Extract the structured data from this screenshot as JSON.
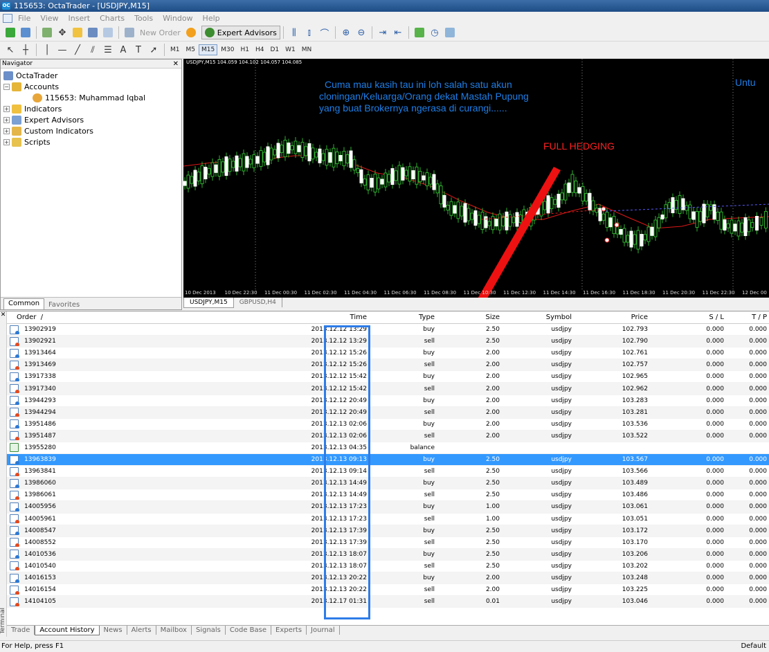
{
  "window": {
    "title": "115653: OctaTrader - [USDJPY,M15]"
  },
  "menu": [
    "File",
    "View",
    "Insert",
    "Charts",
    "Tools",
    "Window",
    "Help"
  ],
  "toolbar": {
    "new_order": "New Order",
    "expert_advisors": "Expert Advisors"
  },
  "timeframes": [
    "M1",
    "M5",
    "M15",
    "M30",
    "H1",
    "H4",
    "D1",
    "W1",
    "MN"
  ],
  "active_timeframe": "M15",
  "navigator": {
    "title": "Navigator",
    "root": "OctaTrader",
    "accounts": "Accounts",
    "account": "115653: Muhammad Iqbal",
    "indicators": "Indicators",
    "experts": "Expert Advisors",
    "custom": "Custom Indicators",
    "scripts": "Scripts",
    "tabs": [
      "Common",
      "Favorites"
    ]
  },
  "chart": {
    "info": "USDJPY,M15  104.059 104.102 104.057 104.085",
    "overlay_lines": [
      "Cuma mau kasih tau ini loh salah satu akun",
      "cloningan/Keluarga/Orang dekat Mastah Pupung",
      "yang buat Brokernya ngerasa di curangi......"
    ],
    "hedge": "FULL HEDGING",
    "untu": "Untu",
    "xlabels": [
      "10 Dec 2013",
      "10 Dec 22:30",
      "11 Dec 00:30",
      "11 Dec 02:30",
      "11 Dec 04:30",
      "11 Dec 06:30",
      "11 Dec 08:30",
      "11 Dec 10:30",
      "11 Dec 12:30",
      "11 Dec 14:30",
      "11 Dec 16:30",
      "11 Dec 18:30",
      "11 Dec 20:30",
      "11 Dec 22:30",
      "12 Dec 00"
    ],
    "tabs": [
      "USDJPY,M15",
      "GBPUSD,H4"
    ]
  },
  "terminal": {
    "columns": {
      "order": "Order",
      "time": "Time",
      "type": "Type",
      "size": "Size",
      "symbol": "Symbol",
      "price": "Price",
      "sl": "S / L",
      "tp": "T / P"
    },
    "rows": [
      {
        "order": "13902919",
        "time": "2013.12.12 13:29",
        "type": "buy",
        "size": "2.50",
        "symbol": "usdjpy",
        "price": "102.793",
        "sl": "0.000",
        "tp": "0.000"
      },
      {
        "order": "13902921",
        "time": "2013.12.12 13:29",
        "type": "sell",
        "size": "2.50",
        "symbol": "usdjpy",
        "price": "102.790",
        "sl": "0.000",
        "tp": "0.000"
      },
      {
        "order": "13913464",
        "time": "2013.12.12 15:26",
        "type": "buy",
        "size": "2.00",
        "symbol": "usdjpy",
        "price": "102.761",
        "sl": "0.000",
        "tp": "0.000"
      },
      {
        "order": "13913469",
        "time": "2013.12.12 15:26",
        "type": "sell",
        "size": "2.00",
        "symbol": "usdjpy",
        "price": "102.757",
        "sl": "0.000",
        "tp": "0.000"
      },
      {
        "order": "13917338",
        "time": "2013.12.12 15:42",
        "type": "buy",
        "size": "2.00",
        "symbol": "usdjpy",
        "price": "102.965",
        "sl": "0.000",
        "tp": "0.000"
      },
      {
        "order": "13917340",
        "time": "2013.12.12 15:42",
        "type": "sell",
        "size": "2.00",
        "symbol": "usdjpy",
        "price": "102.962",
        "sl": "0.000",
        "tp": "0.000"
      },
      {
        "order": "13944293",
        "time": "2013.12.12 20:49",
        "type": "buy",
        "size": "2.00",
        "symbol": "usdjpy",
        "price": "103.283",
        "sl": "0.000",
        "tp": "0.000"
      },
      {
        "order": "13944294",
        "time": "2013.12.12 20:49",
        "type": "sell",
        "size": "2.00",
        "symbol": "usdjpy",
        "price": "103.281",
        "sl": "0.000",
        "tp": "0.000"
      },
      {
        "order": "13951486",
        "time": "2013.12.13 02:06",
        "type": "buy",
        "size": "2.00",
        "symbol": "usdjpy",
        "price": "103.536",
        "sl": "0.000",
        "tp": "0.000"
      },
      {
        "order": "13951487",
        "time": "2013.12.13 02:06",
        "type": "sell",
        "size": "2.00",
        "symbol": "usdjpy",
        "price": "103.522",
        "sl": "0.000",
        "tp": "0.000"
      },
      {
        "order": "13955280",
        "time": "2013.12.13 04:35",
        "type": "balance",
        "size": "",
        "symbol": "",
        "price": "",
        "sl": "",
        "tp": ""
      },
      {
        "order": "13963839",
        "time": "2013.12.13 09:13",
        "type": "buy",
        "size": "2.50",
        "symbol": "usdjpy",
        "price": "103.567",
        "sl": "0.000",
        "tp": "0.000",
        "selected": true
      },
      {
        "order": "13963841",
        "time": "2013.12.13 09:14",
        "type": "sell",
        "size": "2.50",
        "symbol": "usdjpy",
        "price": "103.566",
        "sl": "0.000",
        "tp": "0.000"
      },
      {
        "order": "13986060",
        "time": "2013.12.13 14:49",
        "type": "buy",
        "size": "2.50",
        "symbol": "usdjpy",
        "price": "103.489",
        "sl": "0.000",
        "tp": "0.000"
      },
      {
        "order": "13986061",
        "time": "2013.12.13 14:49",
        "type": "sell",
        "size": "2.50",
        "symbol": "usdjpy",
        "price": "103.486",
        "sl": "0.000",
        "tp": "0.000"
      },
      {
        "order": "14005956",
        "time": "2013.12.13 17:23",
        "type": "buy",
        "size": "1.00",
        "symbol": "usdjpy",
        "price": "103.061",
        "sl": "0.000",
        "tp": "0.000"
      },
      {
        "order": "14005961",
        "time": "2013.12.13 17:23",
        "type": "sell",
        "size": "1.00",
        "symbol": "usdjpy",
        "price": "103.051",
        "sl": "0.000",
        "tp": "0.000"
      },
      {
        "order": "14008547",
        "time": "2013.12.13 17:39",
        "type": "buy",
        "size": "2.50",
        "symbol": "usdjpy",
        "price": "103.172",
        "sl": "0.000",
        "tp": "0.000"
      },
      {
        "order": "14008552",
        "time": "2013.12.13 17:39",
        "type": "sell",
        "size": "2.50",
        "symbol": "usdjpy",
        "price": "103.170",
        "sl": "0.000",
        "tp": "0.000"
      },
      {
        "order": "14010536",
        "time": "2013.12.13 18:07",
        "type": "buy",
        "size": "2.50",
        "symbol": "usdjpy",
        "price": "103.206",
        "sl": "0.000",
        "tp": "0.000"
      },
      {
        "order": "14010540",
        "time": "2013.12.13 18:07",
        "type": "sell",
        "size": "2.50",
        "symbol": "usdjpy",
        "price": "103.202",
        "sl": "0.000",
        "tp": "0.000"
      },
      {
        "order": "14016153",
        "time": "2013.12.13 20:22",
        "type": "buy",
        "size": "2.00",
        "symbol": "usdjpy",
        "price": "103.248",
        "sl": "0.000",
        "tp": "0.000"
      },
      {
        "order": "14016154",
        "time": "2013.12.13 20:22",
        "type": "sell",
        "size": "2.00",
        "symbol": "usdjpy",
        "price": "103.225",
        "sl": "0.000",
        "tp": "0.000"
      },
      {
        "order": "14104105",
        "time": "2013.12.17 01:31",
        "type": "sell",
        "size": "0.01",
        "symbol": "usdjpy",
        "price": "103.046",
        "sl": "0.000",
        "tp": "0.000"
      }
    ],
    "tabs": [
      "Trade",
      "Account History",
      "News",
      "Alerts",
      "Mailbox",
      "Signals",
      "Code Base",
      "Experts",
      "Journal"
    ],
    "active_tab": "Account History",
    "side_label": "Terminal"
  },
  "status": {
    "left": "For Help, press F1",
    "right": "Default"
  }
}
